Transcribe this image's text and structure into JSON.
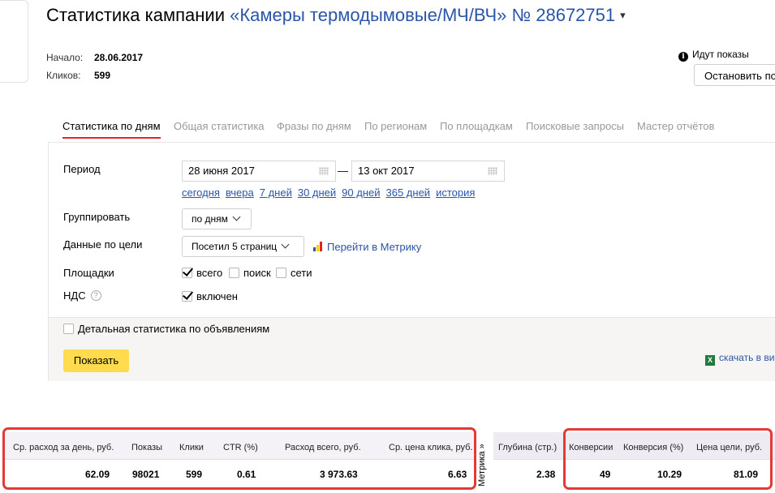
{
  "header": {
    "title_prefix": "Статистика кампании",
    "campaign_name": "«Камеры термодымовые/МЧ/ВЧ»",
    "campaign_number": "№ 28672751",
    "dropdown_arrow": "▾",
    "start_label": "Начало:",
    "start_value": "28.06.2017",
    "clicks_label": "Кликов:",
    "clicks_value": "599",
    "status_text": "Идут показы",
    "stop_button": "Остановить по"
  },
  "tabs": [
    {
      "label": "Статистика по дням"
    },
    {
      "label": "Общая статистика"
    },
    {
      "label": "Фразы по дням"
    },
    {
      "label": "По регионам"
    },
    {
      "label": "По площадкам"
    },
    {
      "label": "Поисковые запросы"
    },
    {
      "label": "Мастер отчётов"
    }
  ],
  "form": {
    "period_label": "Период",
    "date_from": "28 июня 2017",
    "date_separator": "—",
    "date_to": "13 окт 2017",
    "quick_links": [
      "сегодня",
      "вчера",
      "7 дней",
      "30 дней",
      "90 дней",
      "365 дней",
      "история"
    ],
    "group_label": "Группировать",
    "group_value": "по дням",
    "goal_label": "Данные по цели",
    "goal_value": "Посетил 5 страниц",
    "metrika_link": "Перейти в Метрику",
    "platforms_label": "Площадки",
    "platform_all": "всего",
    "platform_search": "поиск",
    "platform_networks": "сети",
    "vat_label": "НДС",
    "vat_help": "?",
    "vat_value": "включен",
    "detailed_label": "Детальная статистика по объявлениям",
    "show_button": "Показать",
    "download_link": "скачать в ви"
  },
  "stats": {
    "headers_left": [
      "Ср. расход за день, руб.",
      "Показы",
      "Клики",
      "CTR (%)",
      "Расход всего, руб.",
      "Ср. цена клика, руб."
    ],
    "values_left": [
      "62.09",
      "98021",
      "599",
      "0.61",
      "3 973.63",
      "6.63"
    ],
    "metrika_label": "Метрика »",
    "headers_right": [
      "Глубина (стр.)",
      "Конверсии",
      "Конверсия (%)",
      "Цена цели, руб."
    ],
    "values_right": [
      "2.38",
      "49",
      "10.29",
      "81.09"
    ]
  }
}
